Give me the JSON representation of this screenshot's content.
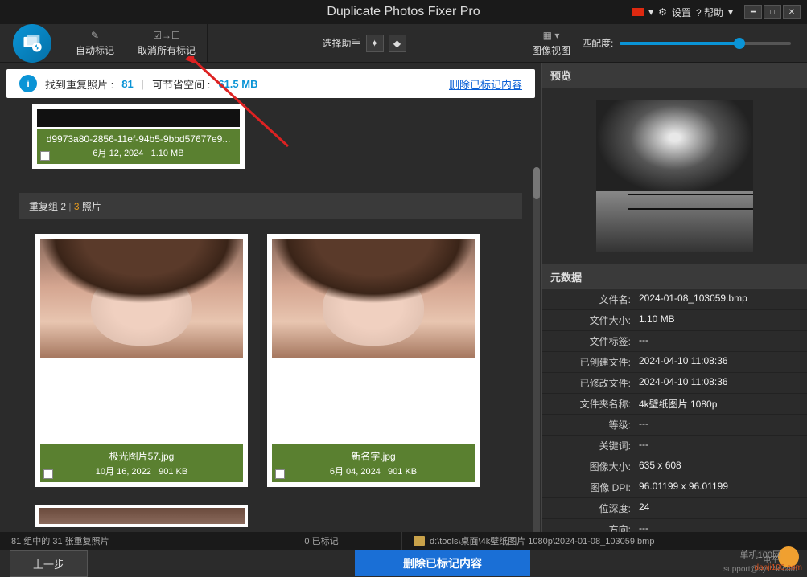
{
  "titlebar": {
    "title": "Duplicate Photos Fixer Pro",
    "settings": "设置",
    "help": "? 帮助"
  },
  "toolbar": {
    "auto_mark": "自动标记",
    "unmark_all": "取消所有标记",
    "select_helper": "选择助手",
    "image_view": "图像视图",
    "match_level": "匹配度:"
  },
  "info": {
    "found_label": "找到重复照片 :",
    "found_count": "81",
    "save_label": "可节省空间 :",
    "save_value": "61.5 MB",
    "delete_marked": "删除已标记内容"
  },
  "group1": {
    "filename": "d9973a80-2856-11ef-94b5-9bbd57677e9...",
    "date": "6月 12, 2024",
    "size": "1.10 MB"
  },
  "group_header": {
    "prefix": "重复组 2",
    "count": "3",
    "suffix": "照片"
  },
  "card2a": {
    "title": "极光图片57.jpg",
    "date": "10月 16, 2022",
    "size": "901 KB"
  },
  "card2b": {
    "title": "新名字.jpg",
    "date": "6月 04, 2024",
    "size": "901 KB"
  },
  "preview": {
    "header": "预览"
  },
  "metadata": {
    "header": "元数据",
    "rows": [
      {
        "k": "文件名:",
        "v": "2024-01-08_103059.bmp"
      },
      {
        "k": "文件大小:",
        "v": "1.10 MB"
      },
      {
        "k": "文件标签:",
        "v": "---"
      },
      {
        "k": "已创建文件:",
        "v": "2024-04-10 11:08:36"
      },
      {
        "k": "已修改文件:",
        "v": "2024-04-10 11:08:36"
      },
      {
        "k": "文件夹名称:",
        "v": "4k壁纸图片 1080p"
      },
      {
        "k": "等级:",
        "v": "---"
      },
      {
        "k": "关键词:",
        "v": "---"
      },
      {
        "k": "图像大小:",
        "v": "635 x 608"
      },
      {
        "k": "图像 DPI:",
        "v": "96.01199 x 96.01199"
      },
      {
        "k": "位深度:",
        "v": "24"
      },
      {
        "k": "方向:",
        "v": "---"
      }
    ]
  },
  "status": {
    "groups": "81 组中的 31 张重复照片",
    "marked": "0 已标记",
    "path": "d:\\tools\\桌面\\4k壁纸图片 1080p\\2024-01-08_103059.bmp"
  },
  "bottom": {
    "prev": "上一步",
    "delete": "删除已标记内容",
    "email_label": "电子邮件:",
    "email": "support@sy***k.com"
  },
  "watermark": {
    "brand": "单机100网",
    "url": "danji100.com"
  }
}
